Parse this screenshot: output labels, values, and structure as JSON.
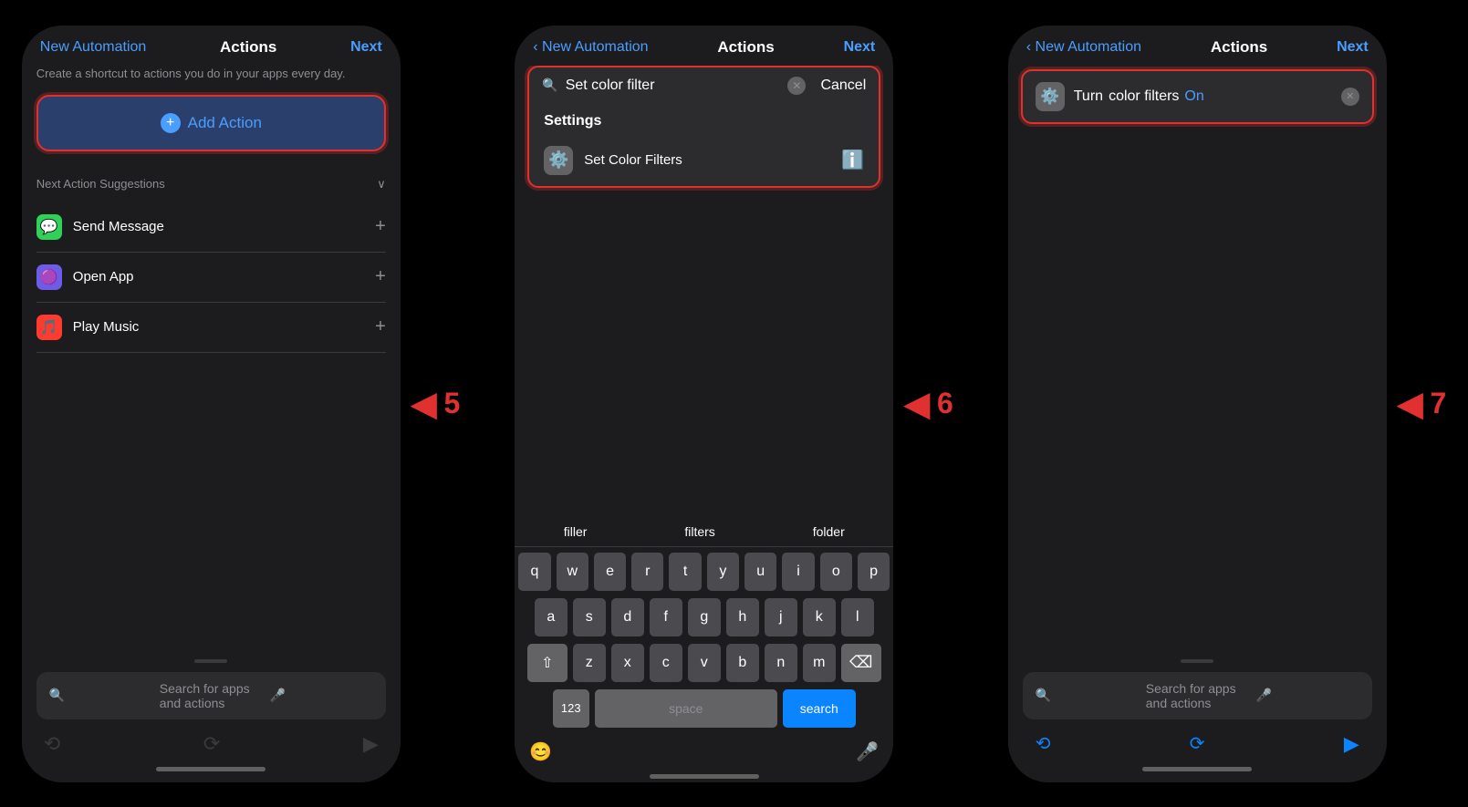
{
  "screen1": {
    "nav_back": "New Automation",
    "nav_title": "Actions",
    "nav_next": "Next",
    "desc": "Create a shortcut to actions you do in your apps every day.",
    "add_action_label": "Add Action",
    "suggestions_title": "Next Action Suggestions",
    "suggestions": [
      {
        "name": "Send Message",
        "icon": "💬",
        "icon_bg": "green"
      },
      {
        "name": "Open App",
        "icon": "🟣",
        "icon_bg": "purple"
      },
      {
        "name": "Play Music",
        "icon": "🎵",
        "icon_bg": "red"
      }
    ],
    "search_placeholder": "Search for apps and actions",
    "step": "5"
  },
  "screen2": {
    "nav_back": "New Automation",
    "nav_title": "Actions",
    "nav_next": "Next",
    "search_value": "Set color filter",
    "cancel_label": "Cancel",
    "settings_header": "Settings",
    "result_name": "Set Color Filters",
    "pred_words": [
      "filler",
      "filters",
      "folder"
    ],
    "keys_row1": [
      "q",
      "w",
      "e",
      "r",
      "t",
      "y",
      "u",
      "i",
      "o",
      "p"
    ],
    "keys_row2": [
      "a",
      "s",
      "d",
      "f",
      "g",
      "h",
      "j",
      "k",
      "l"
    ],
    "keys_row3": [
      "z",
      "x",
      "c",
      "v",
      "b",
      "n",
      "m"
    ],
    "key_123": "123",
    "key_space": "space",
    "key_search": "search",
    "step": "6"
  },
  "screen3": {
    "nav_back": "New Automation",
    "nav_title": "Actions",
    "nav_next": "Next",
    "action_turn": "Turn",
    "action_cf": "color filters",
    "action_on": "On",
    "search_placeholder": "Search for apps and actions",
    "step": "7"
  }
}
